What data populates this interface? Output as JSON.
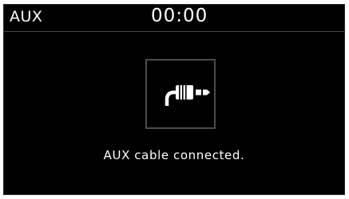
{
  "header": {
    "source": "AUX",
    "clock": "00:00"
  },
  "main": {
    "icon": "aux-cable-plug-icon",
    "message": "AUX cable connected."
  },
  "colors": {
    "background": "#000000",
    "text": "#ffffff",
    "divider": "#4a4a4a",
    "icon_border": "#4c4c4c"
  }
}
